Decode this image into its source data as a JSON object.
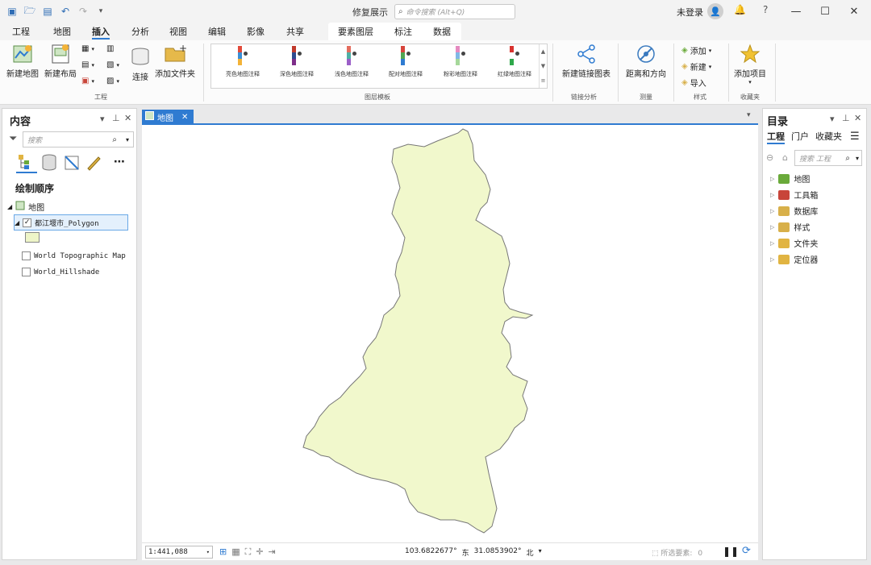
{
  "window": {
    "title": "修复展示",
    "search_placeholder": "命令搜索 (Alt+Q)",
    "user": "未登录",
    "help": "?"
  },
  "tabs": [
    "工程",
    "地图",
    "插入",
    "分析",
    "视图",
    "编辑",
    "影像",
    "共享"
  ],
  "active_tab": "插入",
  "context_tabs": [
    "要素图层",
    "标注",
    "数据"
  ],
  "ribbon": {
    "project_group": {
      "label": "工程",
      "new_map": "新建地图",
      "new_layout": "新建布局",
      "connect": "连接",
      "add_folder": "添加文件夹"
    },
    "layer_templates": {
      "label": "图层模板",
      "items": [
        {
          "label": "亮色地图注释",
          "colors": [
            "#e24a3b",
            "#3a8fd6",
            "#f3b338"
          ]
        },
        {
          "label": "深色地图注释",
          "colors": [
            "#c0392b",
            "#2e4a8e",
            "#7e2e8a"
          ]
        },
        {
          "label": "浅色地图注释",
          "colors": [
            "#e46c5d",
            "#4fb0a5",
            "#9b5fc8"
          ]
        },
        {
          "label": "配对地图注释",
          "colors": [
            "#d7443b",
            "#51a653",
            "#2f7bd1"
          ]
        },
        {
          "label": "粉彩地图注释",
          "colors": [
            "#e58ac0",
            "#7fb8e6",
            "#a6d89b"
          ]
        },
        {
          "label": "红绿地图注释",
          "colors": [
            "#d8322e",
            "#ffffff",
            "#2ea84a"
          ]
        }
      ]
    },
    "link_analysis": {
      "label": "链接分析",
      "button": "新建链接图表"
    },
    "measure": {
      "label": "测量",
      "button": "距离和方向"
    },
    "styles": {
      "label": "样式",
      "add": "添加",
      "new": "新建",
      "import": "导入"
    },
    "favorites": {
      "label": "收藏夹",
      "button": "添加项目"
    }
  },
  "contents_pane": {
    "title": "内容",
    "search_placeholder": "搜索",
    "section": "绘制顺序",
    "map_label": "地图",
    "layers": [
      {
        "name": "都江堰市_Polygon",
        "checked": true,
        "selected": true
      },
      {
        "name": "World Topographic Map",
        "checked": false,
        "selected": false
      },
      {
        "name": "World_Hillshade",
        "checked": false,
        "selected": false
      }
    ],
    "symbol_color": "#eef5c8"
  },
  "map": {
    "tab_label": "地图",
    "fill_color": "#f1f8cc",
    "outline_color": "#777777",
    "scale": "1:441,088",
    "lon": "103.6822677°",
    "lon_dir": "东",
    "lat": "31.0853902°",
    "lat_dir": "北",
    "selected_features_label": "所选要素:",
    "selected_features_count": "0"
  },
  "catalog_pane": {
    "title": "目录",
    "tabs": [
      "工程",
      "门户",
      "收藏夹"
    ],
    "active_tab": "工程",
    "search_placeholder": "搜索 工程",
    "items": [
      {
        "label": "地图",
        "color": "#6aaa3a"
      },
      {
        "label": "工具箱",
        "color": "#c8453a"
      },
      {
        "label": "数据库",
        "color": "#d8b04a"
      },
      {
        "label": "样式",
        "color": "#d8b04a"
      },
      {
        "label": "文件夹",
        "color": "#e1b442"
      },
      {
        "label": "定位器",
        "color": "#e1b442"
      }
    ]
  }
}
